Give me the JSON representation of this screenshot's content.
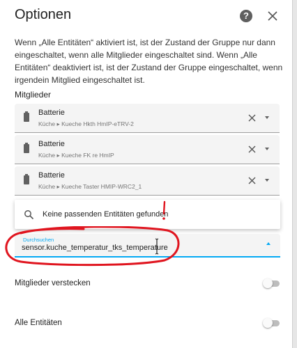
{
  "dialog": {
    "title": "Optionen",
    "description": "Wenn „Alle Entitäten“ aktiviert ist, ist der Zustand der Gruppe nur dann eingeschaltet, wenn alle Mitglieder eingeschaltet sind. Wenn „Alle Entitäten“ deaktiviert ist, ist der Zustand der Gruppe eingeschaltet, wenn irgendein Mitglied eingeschaltet ist.",
    "help_icon_glyph": "?"
  },
  "members": {
    "label": "Mitglieder",
    "items": [
      {
        "name": "Batterie",
        "area": "Küche",
        "separator": "▸",
        "device": "Kueche Hkth HmIP-eTRV-2"
      },
      {
        "name": "Batterie",
        "area": "Küche",
        "separator": "▸",
        "device": "Kueche FK re HmIP"
      },
      {
        "name": "Batterie",
        "area": "Küche",
        "separator": "▸",
        "device": "Kueche Taster HMIP-WRC2_1"
      }
    ]
  },
  "search": {
    "label": "Durchsuchen",
    "value": "sensor.kuche_temperatur_tks_temperature",
    "no_results": "Keine passenden Entitäten gefunden"
  },
  "options": {
    "hide_members_label": "Mitglieder verstecken",
    "all_entities_label": "Alle Entitäten",
    "hide_members_enabled": false,
    "all_entities_enabled": false
  },
  "colors": {
    "accent": "#03a9f4",
    "annotation": "#e0151f"
  },
  "icons": [
    "help-icon",
    "close-icon",
    "battery-icon",
    "clear-icon",
    "chevron-down-icon",
    "search-icon",
    "chevron-up-icon"
  ]
}
